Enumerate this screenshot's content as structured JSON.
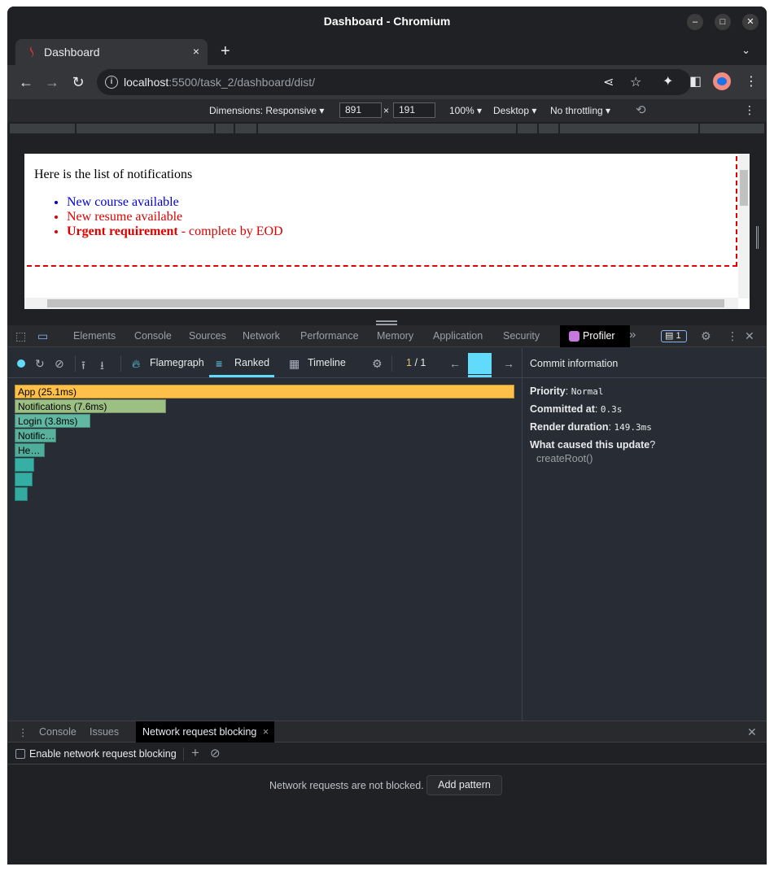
{
  "window": {
    "title": "Dashboard - Chromium"
  },
  "tab": {
    "label": "Dashboard",
    "close": "×",
    "new_tab": "+"
  },
  "address_bar": {
    "host": "localhost",
    "path": ":5500/task_2/dashboard/dist/"
  },
  "device_toolbar": {
    "dimensions": "Dimensions: Responsive ▾",
    "width": "891",
    "times": "×",
    "height": "191",
    "zoom": "100% ▾",
    "device_type": "Desktop ▾",
    "throttling": "No throttling ▾"
  },
  "page": {
    "intro": "Here is the list of notifications",
    "notifications": [
      {
        "text": "New course available",
        "color": "#0000dd"
      },
      {
        "text": "New resume available",
        "color": "#dd0000"
      },
      {
        "strong": "Urgent requirement",
        "rest": " - complete by EOD",
        "color": "#dd0000"
      }
    ]
  },
  "devtools": {
    "tabs": [
      "Elements",
      "Console",
      "Sources",
      "Network",
      "Performance",
      "Memory",
      "Application",
      "Security"
    ],
    "active_tab": "Profiler",
    "more": "»",
    "issues_badge": "1",
    "profiler": {
      "views": [
        "Flamegraph",
        "Ranked",
        "Timeline"
      ],
      "active_view": "Ranked",
      "commit_current": "1",
      "commit_separator": "/",
      "commit_total": "1",
      "ranked": [
        {
          "label": "App (25.1ms)",
          "duration": 25.1,
          "color": "#ffc049"
        },
        {
          "label": "Notifications (7.6ms)",
          "duration": 7.6,
          "color": "#9cbf84"
        },
        {
          "label": "Login (3.8ms)",
          "duration": 3.8,
          "color": "#60b7a2"
        },
        {
          "label": "Notific…",
          "duration": 2.1,
          "color": "#57b19d"
        },
        {
          "label": "He…",
          "duration": 1.5,
          "color": "#4fad9b"
        },
        {
          "label": "",
          "duration": 1.0,
          "color": "#36b0a4"
        },
        {
          "label": "",
          "duration": 0.9,
          "color": "#34ada2"
        },
        {
          "label": "",
          "duration": 0.6,
          "color": "#33aba1"
        }
      ]
    },
    "commit_info": {
      "header": "Commit information",
      "priority_label": "Priority",
      "priority_value": "Normal",
      "committed_label": "Committed at",
      "committed_value": "0.3s",
      "render_label": "Render duration",
      "render_value": "149.3ms",
      "cause_label": "What caused this update",
      "cause_value": "createRoot()"
    }
  },
  "drawer": {
    "tabs": [
      "Console",
      "Issues"
    ],
    "active_tab": "Network request blocking",
    "enable_label": "Enable network request blocking",
    "empty_message": "Network requests are not blocked.",
    "add_button": "Add pattern"
  }
}
